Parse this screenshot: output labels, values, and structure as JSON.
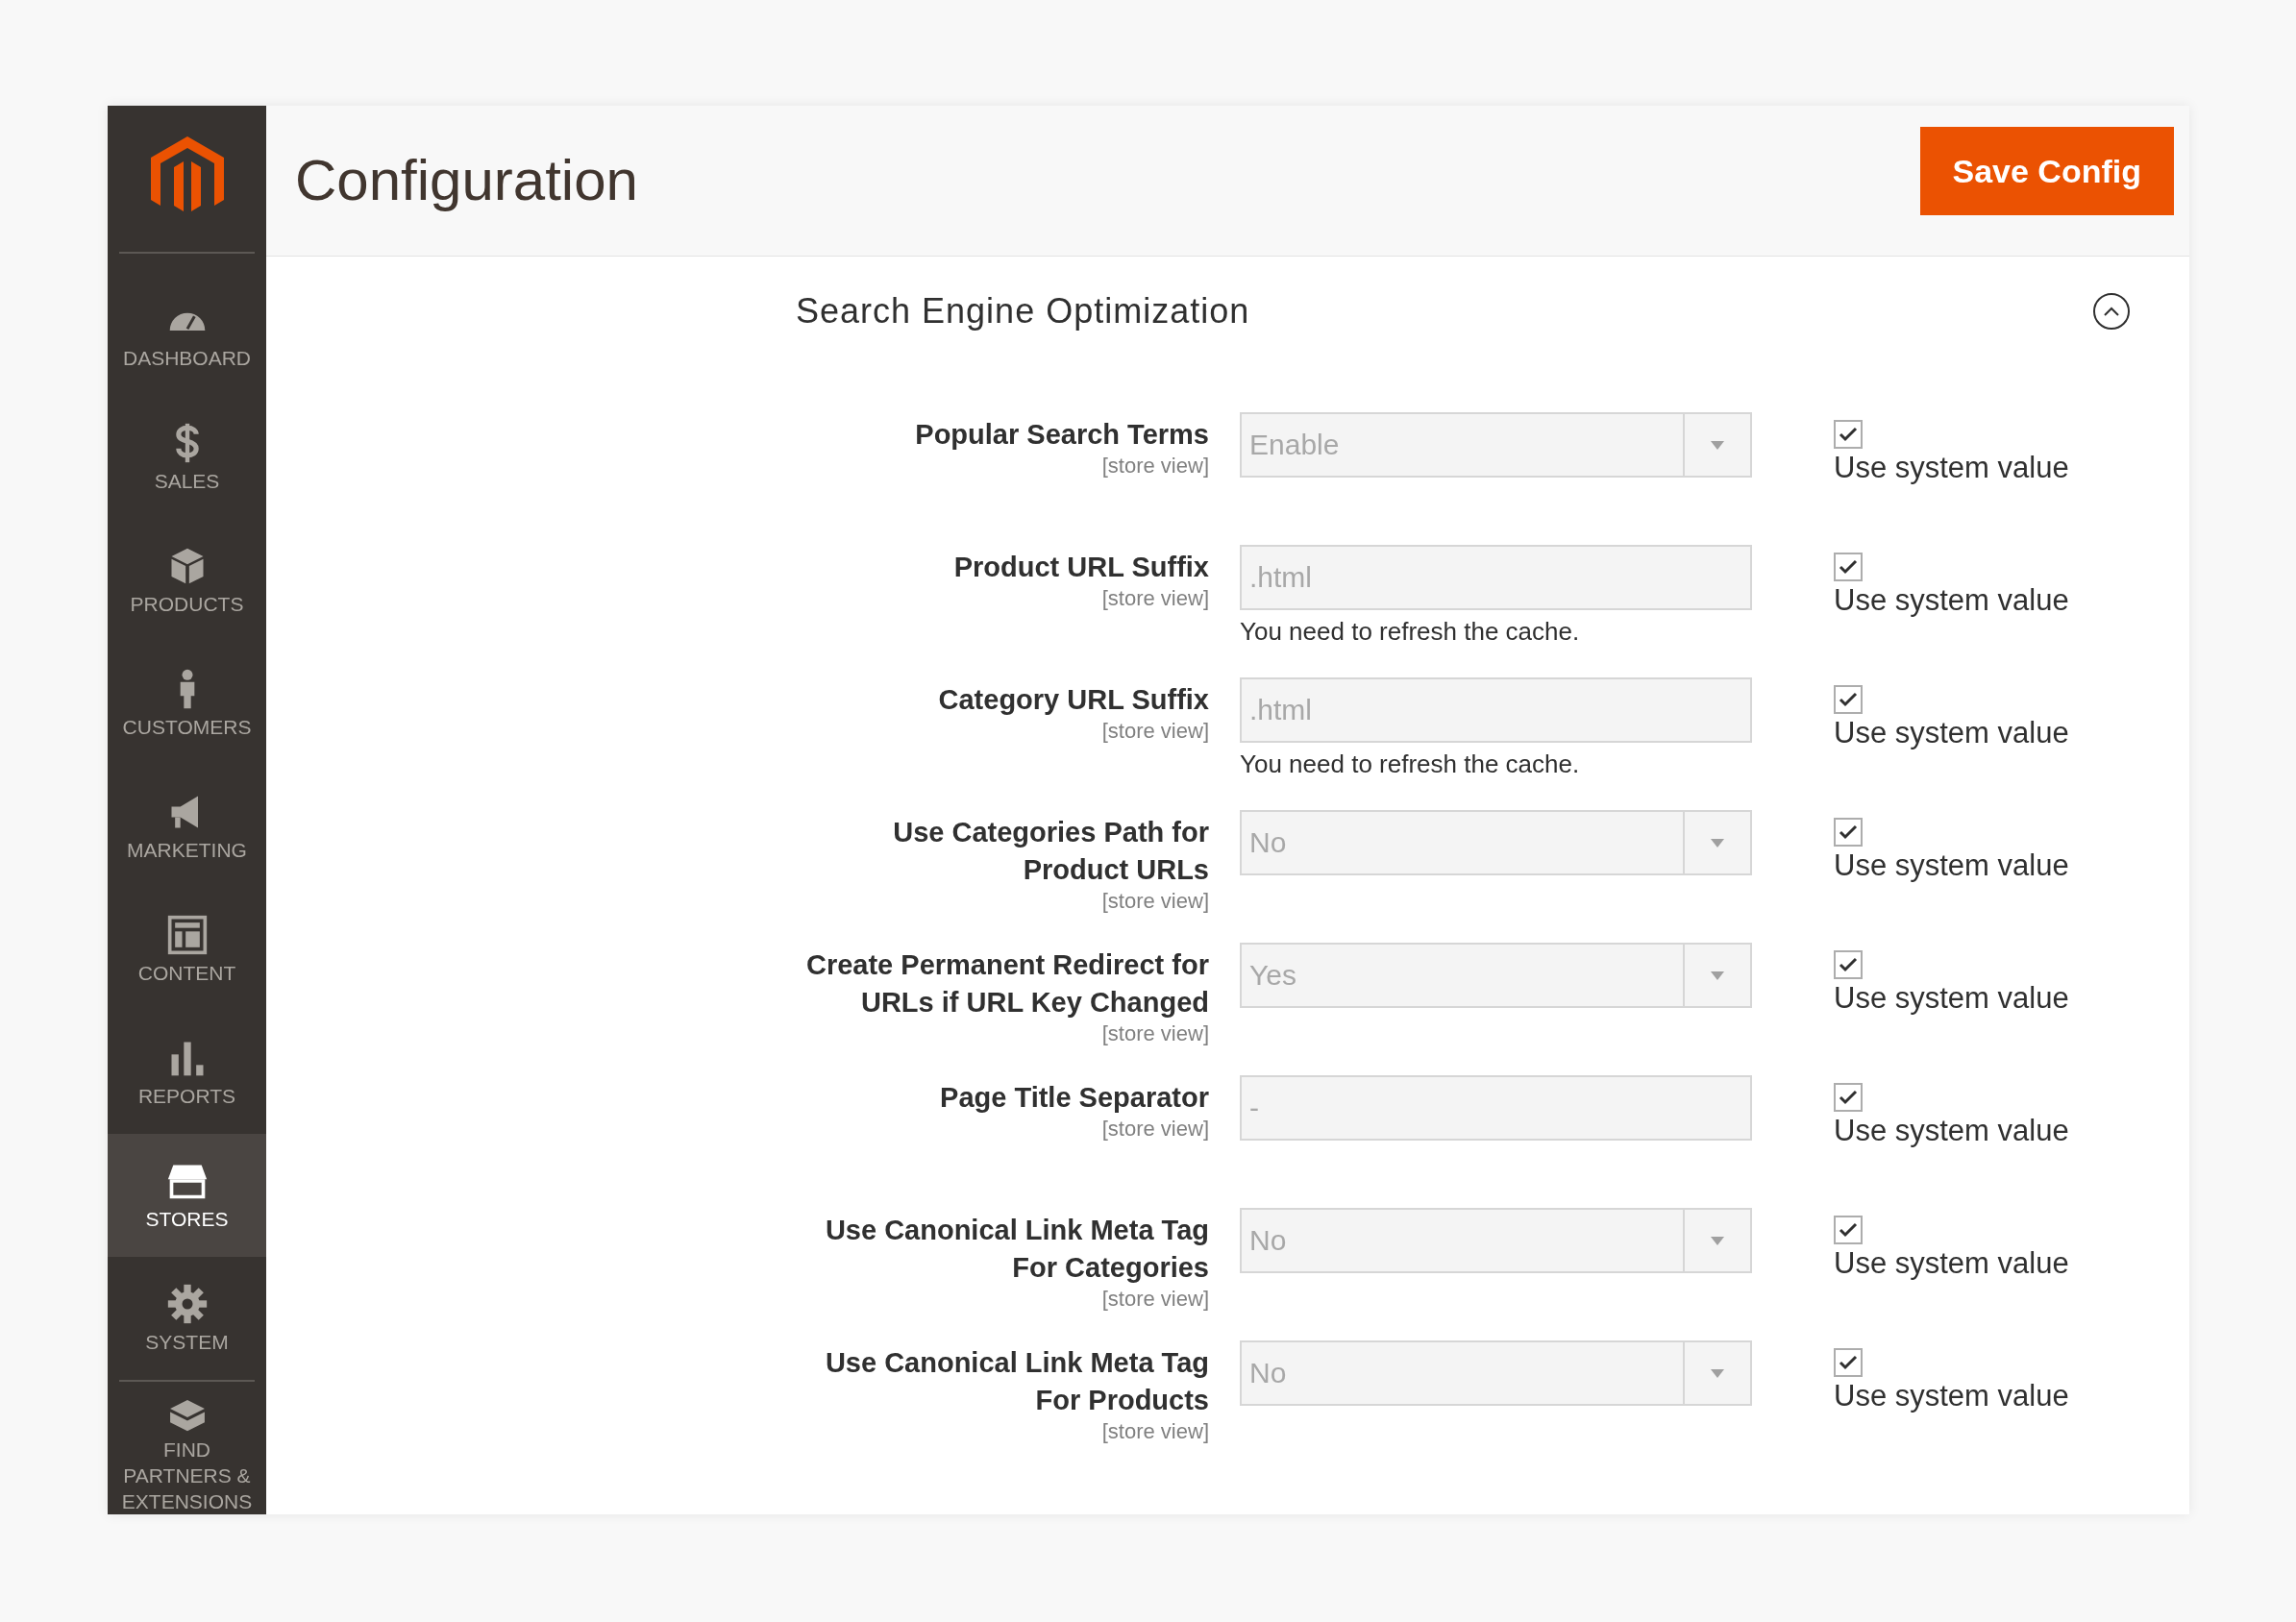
{
  "sidebar": {
    "items": [
      {
        "label": "DASHBOARD",
        "selected": false
      },
      {
        "label": "SALES",
        "selected": false
      },
      {
        "label": "PRODUCTS",
        "selected": false
      },
      {
        "label": "CUSTOMERS",
        "selected": false
      },
      {
        "label": "MARKETING",
        "selected": false
      },
      {
        "label": "CONTENT",
        "selected": false
      },
      {
        "label": "REPORTS",
        "selected": false
      },
      {
        "label": "STORES",
        "selected": true
      },
      {
        "label": "SYSTEM",
        "selected": false
      },
      {
        "label": "FIND PARTNERS & EXTENSIONS",
        "selected": false
      }
    ]
  },
  "header": {
    "title": "Configuration",
    "save_button": "Save Config"
  },
  "section": {
    "title": "Search Engine Optimization",
    "expanded": true,
    "fields": [
      {
        "kind": "select",
        "label": "Popular Search Terms",
        "scope": "[store view]",
        "value": "Enable",
        "checked": true,
        "checkbox_label": "Use system value"
      },
      {
        "kind": "text",
        "label": "Product URL Suffix",
        "scope": "[store view]",
        "value": ".html",
        "note": "You need to refresh the cache.",
        "checked": true,
        "checkbox_label": "Use system value"
      },
      {
        "kind": "text",
        "label": "Category URL Suffix",
        "scope": "[store view]",
        "value": ".html",
        "note": "You need to refresh the cache.",
        "checked": true,
        "checkbox_label": "Use system value"
      },
      {
        "kind": "select",
        "label": "Use Categories Path for Product URLs",
        "scope": "[store view]",
        "value": "No",
        "checked": true,
        "checkbox_label": "Use system value"
      },
      {
        "kind": "select",
        "label": "Create Permanent Redirect for URLs if URL Key Changed",
        "scope": "[store view]",
        "value": "Yes",
        "checked": true,
        "checkbox_label": "Use system value"
      },
      {
        "kind": "text",
        "label": "Page Title Separator",
        "scope": "[store view]",
        "value": "-",
        "checked": true,
        "checkbox_label": "Use system value"
      },
      {
        "kind": "select",
        "label": "Use Canonical Link Meta Tag For Categories",
        "scope": "[store view]",
        "value": "No",
        "checked": true,
        "checkbox_label": "Use system value"
      },
      {
        "kind": "select",
        "label": "Use Canonical Link Meta Tag For Products",
        "scope": "[store view]",
        "value": "No",
        "checked": true,
        "checkbox_label": "Use system value"
      }
    ]
  }
}
